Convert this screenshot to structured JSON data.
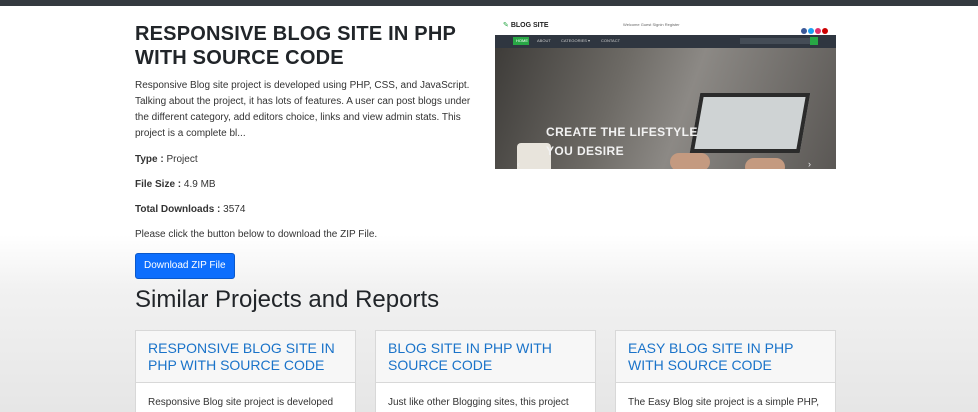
{
  "product": {
    "title": "RESPONSIVE BLOG SITE IN PHP WITH SOURCE CODE",
    "description": "Responsive Blog site project is developed using PHP, CSS, and JavaScript. Talking about the project, it has lots of features. A user can post blogs under the different category, add editors choice, links and view admin stats. This project is a complete bl...",
    "type_label": "Type :",
    "type_value": "Project",
    "size_label": "File Size :",
    "size_value": "4.9 MB",
    "downloads_label": "Total Downloads :",
    "downloads_value": "3574",
    "note": "Please click the button below to download the ZIP File.",
    "download_button": "Download ZIP File"
  },
  "preview": {
    "logo": "BLOG SITE",
    "header_links": "Welcome Guest   Signin   Register",
    "nav": [
      "HOME",
      "ABOUT",
      "CATEGORIES ▾",
      "CONTACT"
    ],
    "caption_line1": "CREATE THE LIFESTYLE",
    "caption_line2": "YOU DESIRE",
    "social_colors": [
      "#3b5998",
      "#1da1f2",
      "#e1306c",
      "#cc0000"
    ]
  },
  "similar": {
    "heading": "Similar Projects and Reports",
    "cards": [
      {
        "title": "RESPONSIVE BLOG SITE IN PHP WITH SOURCE CODE",
        "excerpt": "Responsive Blog site project is developed"
      },
      {
        "title": "BLOG SITE IN PHP WITH SOURCE CODE",
        "excerpt": "Just like other Blogging sites, this project"
      },
      {
        "title": "EASY BLOG SITE IN PHP WITH SOURCE CODE",
        "excerpt": "The Easy Blog site project is a simple PHP,"
      }
    ]
  }
}
